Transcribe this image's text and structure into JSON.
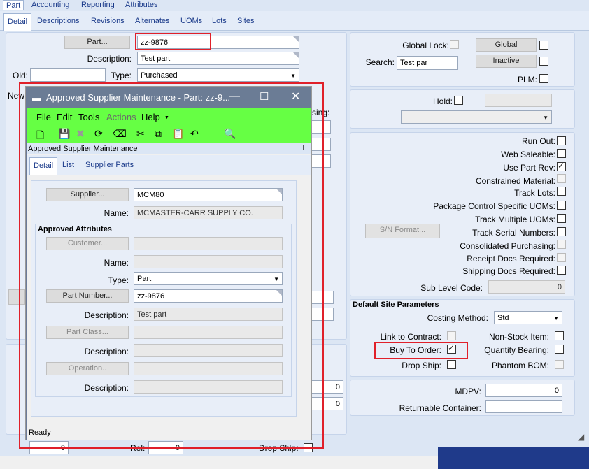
{
  "top_tabs": [
    "Part",
    "Accounting",
    "Reporting",
    "Attributes"
  ],
  "sub_tabs": [
    "Detail",
    "Descriptions",
    "Revisions",
    "Alternates",
    "UOMs",
    "Lots",
    "Sites"
  ],
  "part": {
    "part_button": "Part...",
    "part_value": "zz-9876",
    "description_label": "Description:",
    "description_value": "Test part",
    "old_label": "Old:",
    "type_label": "Type:",
    "type_value": "Purchased",
    "new_label": "New"
  },
  "right": {
    "global_lock_label": "Global Lock:",
    "search_label": "Search:",
    "search_value": "Test par",
    "global_button": "Global",
    "inactive_button": "Inactive",
    "plm_label": "PLM:",
    "hold_label": "Hold:",
    "run_out": "Run Out:",
    "web_saleable": "Web Saleable:",
    "use_part_rev": "Use Part Rev:",
    "constrained_material": "Constrained Material:",
    "track_lots": "Track Lots:",
    "package_control": "Package Control Specific UOMs:",
    "track_multiple_uoms": "Track Multiple UOMs:",
    "sn_format_button": "S/N Format...",
    "track_serial_numbers": "Track Serial Numbers:",
    "consolidated_purchasing": "Consolidated Purchasing:",
    "receipt_docs": "Receipt Docs Required:",
    "shipping_docs": "Shipping Docs Required:",
    "sub_level_code_label": "Sub Level Code:",
    "sub_level_code_value": "0",
    "default_site_title": "Default Site Parameters",
    "costing_method_label": "Costing Method:",
    "costing_method_value": "Std",
    "link_to_contract": "Link to Contract:",
    "non_stock_item": "Non-Stock Item:",
    "buy_to_order": "Buy To Order:",
    "quantity_bearing": "Quantity Bearing:",
    "drop_ship": "Drop Ship:",
    "phantom_bom": "Phantom BOM:",
    "mdpv_label": "MDPV:",
    "mdpv_value": "0",
    "returnable_container": "Returnable Container:"
  },
  "background_fragments": {
    "sing_label": "sing:",
    "val_0_a": "0",
    "val_0_b": "0",
    "bottom_0": "0",
    "rel_label": "Rel:",
    "rel_value": "0",
    "drop_ship_bottom": "Drop Ship:"
  },
  "dialog": {
    "title": "Approved Supplier Maintenance - Part: zz-9...",
    "menu": [
      "File",
      "Edit",
      "Tools",
      "Actions",
      "Help"
    ],
    "subtitle": "Approved Supplier Maintenance",
    "tabs": [
      "Detail",
      "List",
      "Supplier Parts"
    ],
    "supplier_button": "Supplier...",
    "supplier_value": "MCM80",
    "name_label": "Name:",
    "name_value": "MCMASTER-CARR SUPPLY CO.",
    "approved_attributes": "Approved Attributes",
    "customer_button": "Customer...",
    "name2_label": "Name:",
    "type_label": "Type:",
    "type_value": "Part",
    "part_number_button": "Part Number...",
    "part_number_value": "zz-9876",
    "description_label": "Description:",
    "description_value": "Test part",
    "part_class_button": "Part Class...",
    "description2_label": "Description:",
    "operation_button": "Operation..",
    "description3_label": "Description:",
    "status": "Ready"
  },
  "colors": {
    "highlight_red": "#e0202a",
    "menubar_green": "#66ff44",
    "titlebar": "#6b7c95"
  }
}
